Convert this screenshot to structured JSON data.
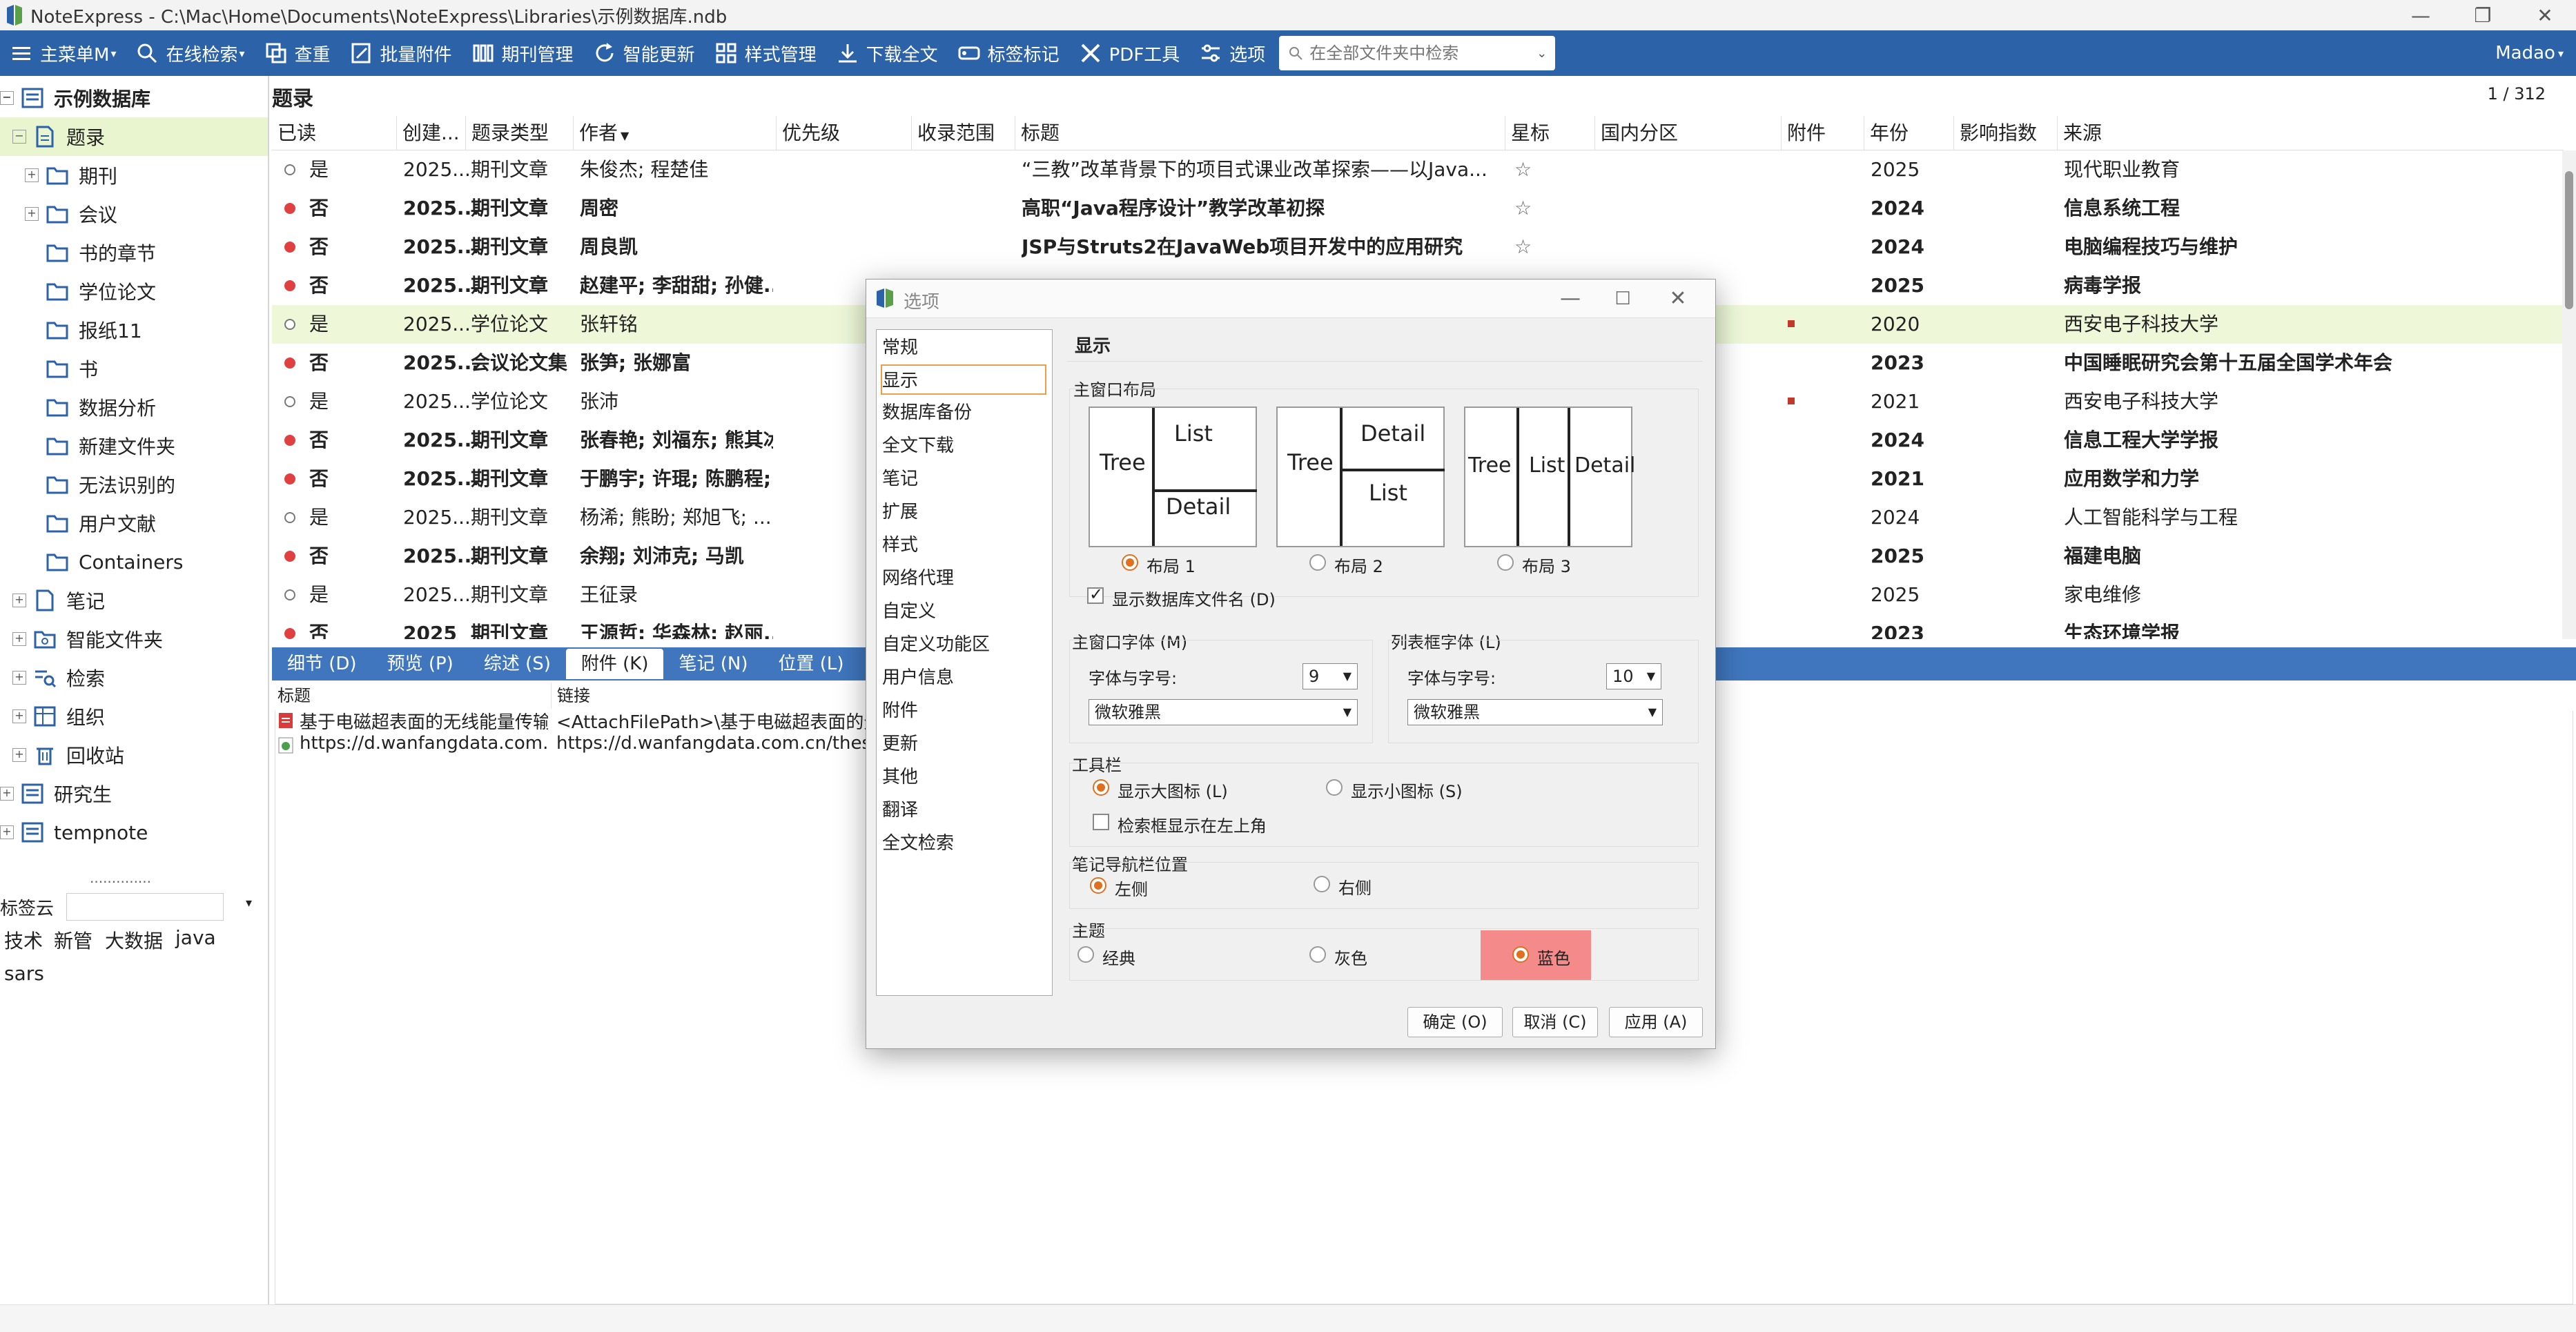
{
  "window": {
    "title": "NoteExpress - C:\\Mac\\Home\\Documents\\NoteExpress\\Libraries\\示例数据库.ndb"
  },
  "toolbar": {
    "items": [
      "主菜单M",
      "在线检索",
      "查重",
      "批量附件",
      "期刊管理",
      "智能更新",
      "样式管理",
      "下载全文",
      "标签标记",
      "PDF工具",
      "选项"
    ],
    "search_placeholder": "在全部文件夹中检索",
    "user": "Madao"
  },
  "tree": {
    "root": "示例数据库",
    "items": [
      "题录",
      "期刊",
      "会议",
      "书的章节",
      "学位论文",
      "报纸11",
      "书",
      "数据分析",
      "新建文件夹",
      "无法识别的",
      "用户文献",
      "Containers",
      "笔记",
      "智能文件夹",
      "检索",
      "组织",
      "回收站"
    ],
    "other_dbs": [
      "研究生",
      "tempnote"
    ],
    "separator": "..............",
    "tagcloud_label": "标签云",
    "tags": [
      "技术",
      "新管",
      "大数据",
      "java",
      "sars"
    ]
  },
  "list": {
    "title": "题录",
    "count": "1 / 312",
    "columns": [
      "已读",
      "创建...",
      "题录类型",
      "作者",
      "优先级",
      "收录范围",
      "标题",
      "星标",
      "国内分区",
      "附件",
      "年份",
      "影响指数",
      "来源"
    ],
    "rows": [
      {
        "read": "是",
        "created": "2025...",
        "type": "期刊文章",
        "author": "朱俊杰; 程楚佳",
        "title": "“三教”改革背景下的项目式课业改革探索——以Java...",
        "year": "2025",
        "source": "现代职业教育",
        "star": "☆"
      },
      {
        "read": "否",
        "created": "2025...",
        "type": "期刊文章",
        "author": "周密",
        "title": "高职“Java程序设计”教学改革初探",
        "year": "2024",
        "source": "信息系统工程",
        "star": "☆"
      },
      {
        "read": "否",
        "created": "2025...",
        "type": "期刊文章",
        "author": "周良凯",
        "title": "JSP与Struts2在JavaWeb项目开发中的应用研究",
        "year": "2024",
        "source": "电脑编程技巧与维护",
        "star": "☆"
      },
      {
        "read": "否",
        "created": "2025...",
        "type": "期刊文章",
        "author": "赵建平; 李甜甜; 孙健...",
        "title": "",
        "year": "2025",
        "source": "病毒学报",
        "star": ""
      },
      {
        "read": "是",
        "created": "2025...",
        "type": "学位论文",
        "author": "张轩铭",
        "title": "",
        "year": "2020",
        "source": "西安电子科技大学",
        "star": ""
      },
      {
        "read": "否",
        "created": "2025...",
        "type": "会议论文集",
        "author": "张笋; 张娜富",
        "title": "",
        "year": "2023",
        "source": "中国睡眠研究会第十五届全国学术年会",
        "star": ""
      },
      {
        "read": "是",
        "created": "2025...",
        "type": "学位论文",
        "author": "张沛",
        "title": "",
        "year": "2021",
        "source": "西安电子科技大学",
        "star": ""
      },
      {
        "read": "否",
        "created": "2025...",
        "type": "期刊文章",
        "author": "张春艳; 刘福东; 熊其冰",
        "title": "",
        "year": "2024",
        "source": "信息工程大学学报",
        "star": ""
      },
      {
        "read": "否",
        "created": "2025...",
        "type": "期刊文章",
        "author": "于鹏宇; 许琨; 陈鹏程;...",
        "title": "",
        "year": "2021",
        "source": "应用数学和力学",
        "star": ""
      },
      {
        "read": "是",
        "created": "2025...",
        "type": "期刊文章",
        "author": "杨浠; 熊盼; 郑旭飞; ...",
        "title": "",
        "year": "2024",
        "source": "人工智能科学与工程",
        "star": ""
      },
      {
        "read": "否",
        "created": "2025...",
        "type": "期刊文章",
        "author": "余翔; 刘沛克; 马凯",
        "title": "",
        "year": "2025",
        "source": "福建电脑",
        "star": ""
      },
      {
        "read": "是",
        "created": "2025...",
        "type": "期刊文章",
        "author": "王征录",
        "title": "",
        "year": "2025",
        "source": "家电维修",
        "star": ""
      },
      {
        "read": "否",
        "created": "2025",
        "type": "期刊文章",
        "author": "王源哲; 华森林; 赵丽...",
        "title": "",
        "year": "2023",
        "source": "生态环境学报",
        "star": ""
      }
    ]
  },
  "bottom": {
    "tabs": [
      "细节 (D)",
      "预览 (P)",
      "综述 (S)",
      "附件 (K)",
      "笔记 (N)",
      "位置 (L)"
    ],
    "columns": [
      "标题",
      "链接"
    ],
    "rows": [
      {
        "title": "基于电磁超表面的无线能量传输...",
        "link": "<AttachFilePath>\\基于电磁超表面的无线"
      },
      {
        "title": "https://d.wanfangdata.com.c...",
        "link": "https://d.wanfangdata.com.cn/thesis/Cl"
      }
    ]
  },
  "dialog": {
    "title": "选项",
    "nav": [
      "常规",
      "显示",
      "数据库备份",
      "全文下载",
      "笔记",
      "扩展",
      "样式",
      "网络代理",
      "自定义",
      "自定义功能区",
      "用户信息",
      "附件",
      "更新",
      "其他",
      "翻译",
      "全文检索"
    ],
    "section": "显示",
    "main_layout_label": "主窗口布局",
    "layouts": [
      {
        "label": "布局 1",
        "parts": [
          "Tree",
          "List",
          "Detail"
        ]
      },
      {
        "label": "布局 2",
        "parts": [
          "Tree",
          "Detail",
          "List"
        ]
      },
      {
        "label": "布局 3",
        "parts": [
          "Tree",
          "List",
          "Detail"
        ]
      }
    ],
    "show_db_filename": "显示数据库文件名 (D)",
    "main_font_label": "主窗口字体 (M)",
    "list_font_label": "列表框字体 (L)",
    "font_size_label": "字体与字号:",
    "main_font_size": "9",
    "list_font_size": "10",
    "main_font_name": "微软雅黑",
    "list_font_name": "微软雅黑",
    "toolbar_label": "工具栏",
    "large_icons": "显示大图标 (L)",
    "small_icons": "显示小图标 (S)",
    "search_top_left": "检索框显示在左上角",
    "note_nav_label": "笔记导航栏位置",
    "left": "左侧",
    "right": "右侧",
    "theme_label": "主题",
    "themes": [
      "经典",
      "灰色",
      "蓝色"
    ],
    "ok": "确定 (O)",
    "cancel": "取消 (C)",
    "apply": "应用 (A)"
  }
}
